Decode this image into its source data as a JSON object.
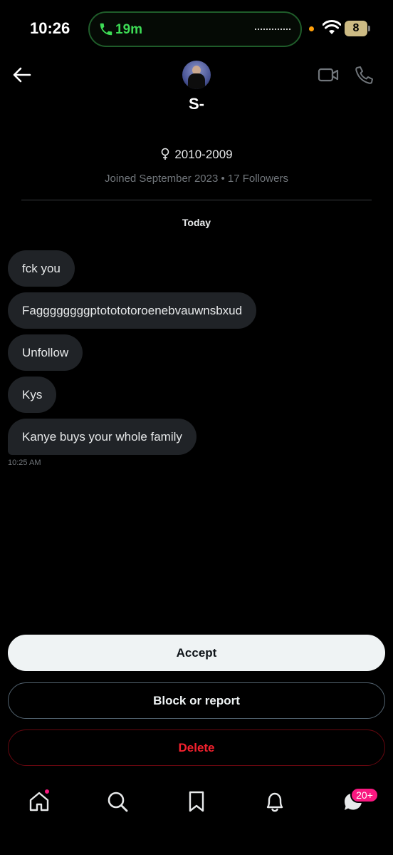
{
  "status_bar": {
    "time": "10:26",
    "call_duration": "19m",
    "battery_level": "8",
    "call_color": "#3ddc55"
  },
  "header": {
    "back_icon": "back-arrow-icon",
    "display_name": "S-",
    "video_icon": "video-camera-icon",
    "call_icon": "phone-icon"
  },
  "profile": {
    "gender_icon": "female-symbol-icon",
    "birth_years": "2010-2009",
    "joined_text": "Joined September 2023 • 17 Followers"
  },
  "conversation": {
    "day_label": "Today",
    "messages": [
      "fck you",
      "Faggggggggptotototoroenebvauwnsbxud",
      "Unfollow",
      "Kys",
      "Kanye buys your whole family"
    ],
    "last_message_time": "10:25 AM"
  },
  "actions": {
    "accept_label": "Accept",
    "block_label": "Block or report",
    "delete_label": "Delete",
    "delete_color": "#f4212e"
  },
  "bottom_nav": {
    "items": [
      "home-icon",
      "search-icon",
      "bookmark-icon",
      "bell-icon",
      "messages-icon"
    ],
    "messages_badge": "20+",
    "badge_color": "#f91880"
  }
}
